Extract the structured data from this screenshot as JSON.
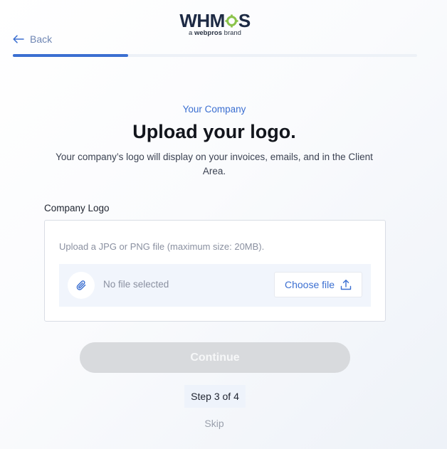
{
  "brand": {
    "logo_text_pre": "WHM",
    "logo_text_post": "S",
    "subline_pre": "a",
    "subline_brand": "webpros",
    "subline_post": "brand"
  },
  "nav": {
    "back_label": "Back"
  },
  "progress": {
    "value": 0.285
  },
  "header": {
    "eyebrow": "Your Company",
    "title": "Upload your logo.",
    "description": "Your company’s logo will display on your invoices, emails, and in the Client Area."
  },
  "form": {
    "field_label": "Company Logo",
    "hint": "Upload a JPG or PNG file (maximum size: 20MB).",
    "file_status": "No file selected",
    "choose_label": "Choose file"
  },
  "actions": {
    "continue_label": "Continue",
    "step_label": "Step 3 of 4",
    "skip_label": "Skip"
  },
  "colors": {
    "accent": "#3b6fd1",
    "logo_gear": "#8bc34a",
    "disabled_button": "#d8dadd"
  },
  "icons": {
    "back": "arrow-left-icon",
    "clip": "paperclip-icon",
    "upload": "upload-icon",
    "gear": "gear-icon"
  }
}
